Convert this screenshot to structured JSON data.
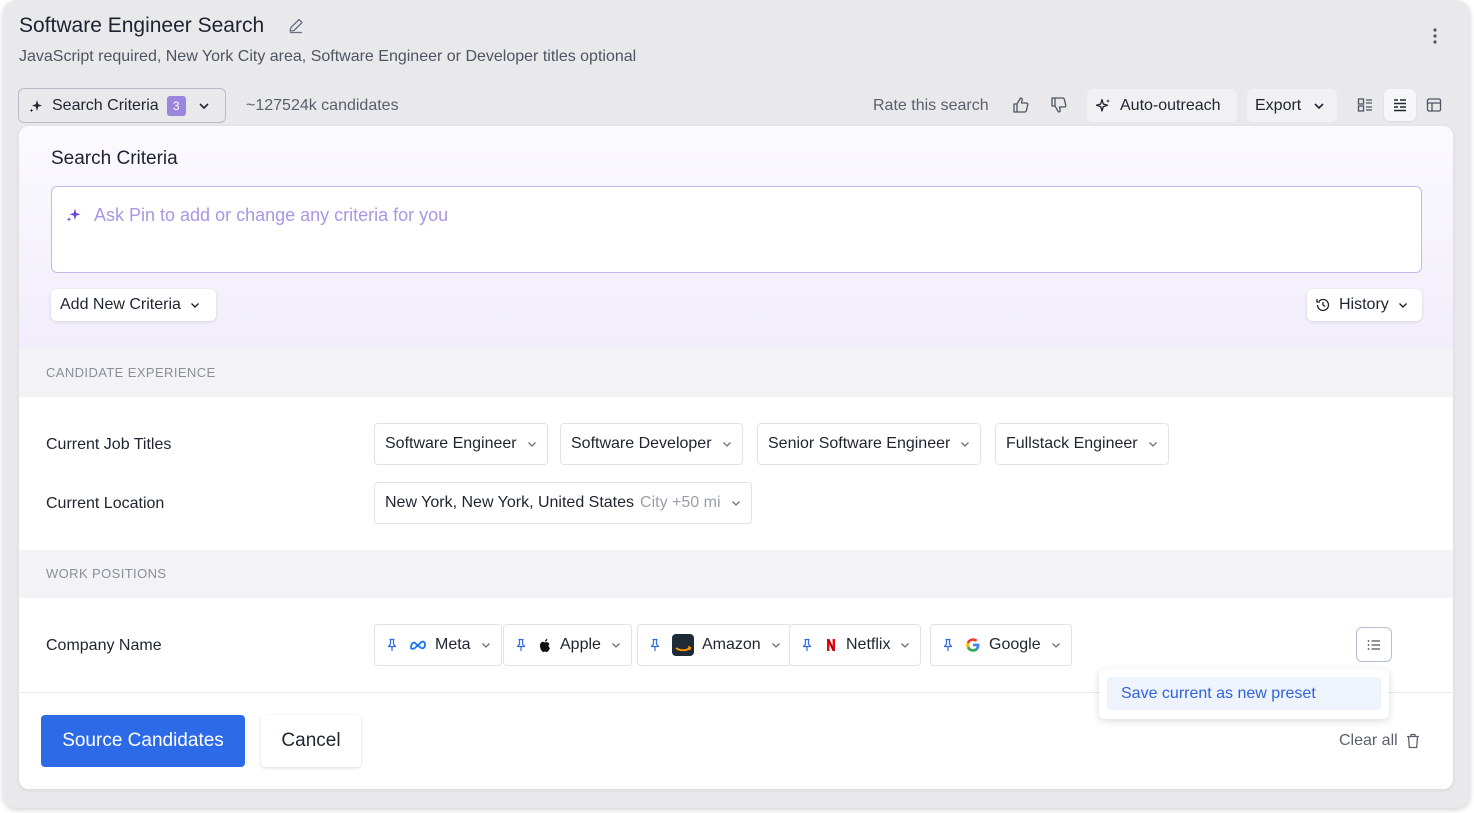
{
  "header": {
    "title": "Software Engineer Search",
    "subtitle": "JavaScript required, New York City area, Software Engineer or Developer titles optional"
  },
  "toolbar": {
    "criteria_label": "Search Criteria",
    "criteria_count": "3",
    "candidate_count": "~127524k candidates",
    "rate_label": "Rate this search",
    "auto_outreach_label": "Auto-outreach",
    "export_label": "Export",
    "active_view": "compact-list"
  },
  "panel": {
    "title": "Search Criteria",
    "ask_placeholder": "Ask Pin to add or change any criteria for you",
    "add_criteria_label": "Add New Criteria",
    "history_label": "History"
  },
  "sections": {
    "experience": {
      "label": "CANDIDATE EXPERIENCE",
      "job_titles_label": "Current Job Titles",
      "job_titles": [
        "Software Engineer",
        "Software Developer",
        "Senior Software Engineer",
        "Fullstack Engineer"
      ],
      "location_label": "Current Location",
      "location_value": "New York, New York, United States",
      "location_radius": "City +50 mi"
    },
    "work": {
      "label": "WORK POSITIONS",
      "company_label": "Company Name",
      "companies": [
        {
          "name": "Meta",
          "icon": "meta-logo"
        },
        {
          "name": "Apple",
          "icon": "apple-logo"
        },
        {
          "name": "Amazon",
          "icon": "amazon-logo"
        },
        {
          "name": "Netflix",
          "icon": "netflix-logo"
        },
        {
          "name": "Google",
          "icon": "google-logo"
        }
      ]
    }
  },
  "preset_menu": {
    "item": "Save current as new preset"
  },
  "footer": {
    "source_label": "Source Candidates",
    "cancel_label": "Cancel",
    "clear_label": "Clear all"
  },
  "colors": {
    "primary": "#2d6ae8",
    "accent_purple": "#9a86df",
    "ask_placeholder": "#a996e6"
  }
}
